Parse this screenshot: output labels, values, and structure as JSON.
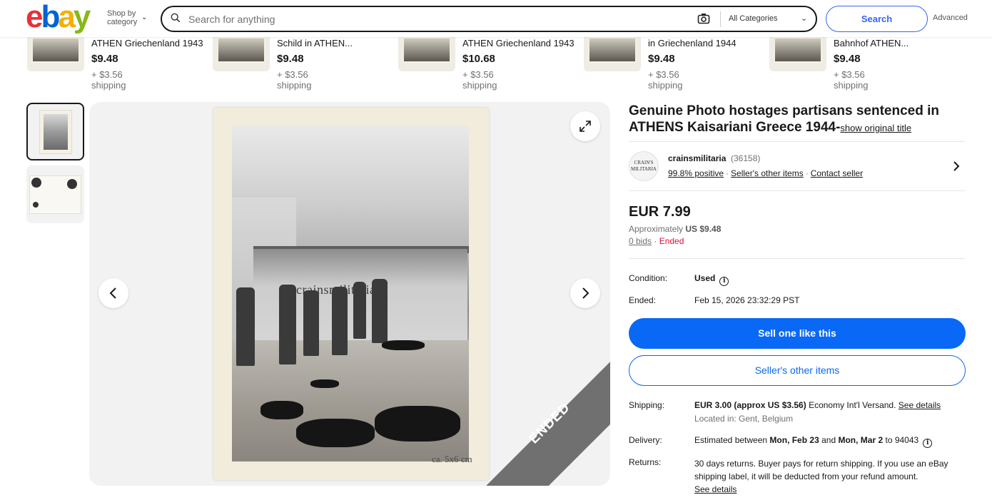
{
  "header": {
    "logo_letters": [
      "e",
      "b",
      "a",
      "y"
    ],
    "shop_by_line1": "Shop by",
    "shop_by_line2": "category",
    "search_placeholder": "Search for anything",
    "category_select": "All Categories",
    "search_button": "Search",
    "advanced_link": "Advanced"
  },
  "related_items": [
    {
      "title": "ATHEN Griechenland 1943",
      "price": "$9.48",
      "shipping": "+ $3.56 shipping"
    },
    {
      "title": "Schild in ATHEN...",
      "price": "$9.48",
      "shipping": "+ $3.56 shipping"
    },
    {
      "title": "ATHEN Griechenland 1943",
      "price": "$10.68",
      "shipping": "+ $3.56 shipping"
    },
    {
      "title": "in Griechenland 1944",
      "price": "$9.48",
      "shipping": "+ $3.56 shipping"
    },
    {
      "title": "Bahnhof ATHEN...",
      "price": "$9.48",
      "shipping": "+ $3.56 shipping"
    }
  ],
  "gallery": {
    "watermark": "crainsmilitaria",
    "size_note": "ca. 5x6 cm",
    "ended_banner": "ENDED"
  },
  "item": {
    "title": "Genuine Photo hostages partisans sentenced in ATHENS Kaisariani Greece 1944-",
    "show_original": "show original title",
    "seller": {
      "logo_line1": "CRAIN'S",
      "logo_line2": "MILITARIA",
      "name": "crainsmilitaria",
      "feedback_count": "(36158)",
      "positive": "99.8% positive",
      "other_items": "Seller's other items",
      "contact": "Contact seller"
    },
    "price": "EUR 7.99",
    "approx_label": "Approximately",
    "approx_value": "US $9.48",
    "bids": "0 bids",
    "status": "Ended",
    "condition_label": "Condition:",
    "condition_value": "Used",
    "ended_label": "Ended:",
    "ended_value": "Feb 15, 2026 23:32:29 PST",
    "sell_button": "Sell one like this",
    "other_items_button": "Seller's other items",
    "shipping_label": "Shipping:",
    "shipping_value": "EUR 3.00 (approx US $3.56)",
    "shipping_method": "Economy Int'l Versand.",
    "shipping_details": "See details",
    "located": "Located in: Gent, Belgium",
    "delivery_label": "Delivery:",
    "delivery_prefix": "Estimated between",
    "delivery_from": "Mon, Feb 23",
    "delivery_and": "and",
    "delivery_to": "Mon, Mar 2",
    "delivery_zip": "to 94043",
    "returns_label": "Returns:",
    "returns_text": "30 days returns. Buyer pays for return shipping. If you use an eBay shipping label, it will be deducted from your refund amount.",
    "returns_details": "See details"
  },
  "colors": {
    "primary_blue": "#0968f6",
    "search_blue": "#3665f3",
    "ended_red": "#e0103a",
    "logo": [
      "#e53238",
      "#0064d2",
      "#f5af02",
      "#86b817"
    ]
  }
}
